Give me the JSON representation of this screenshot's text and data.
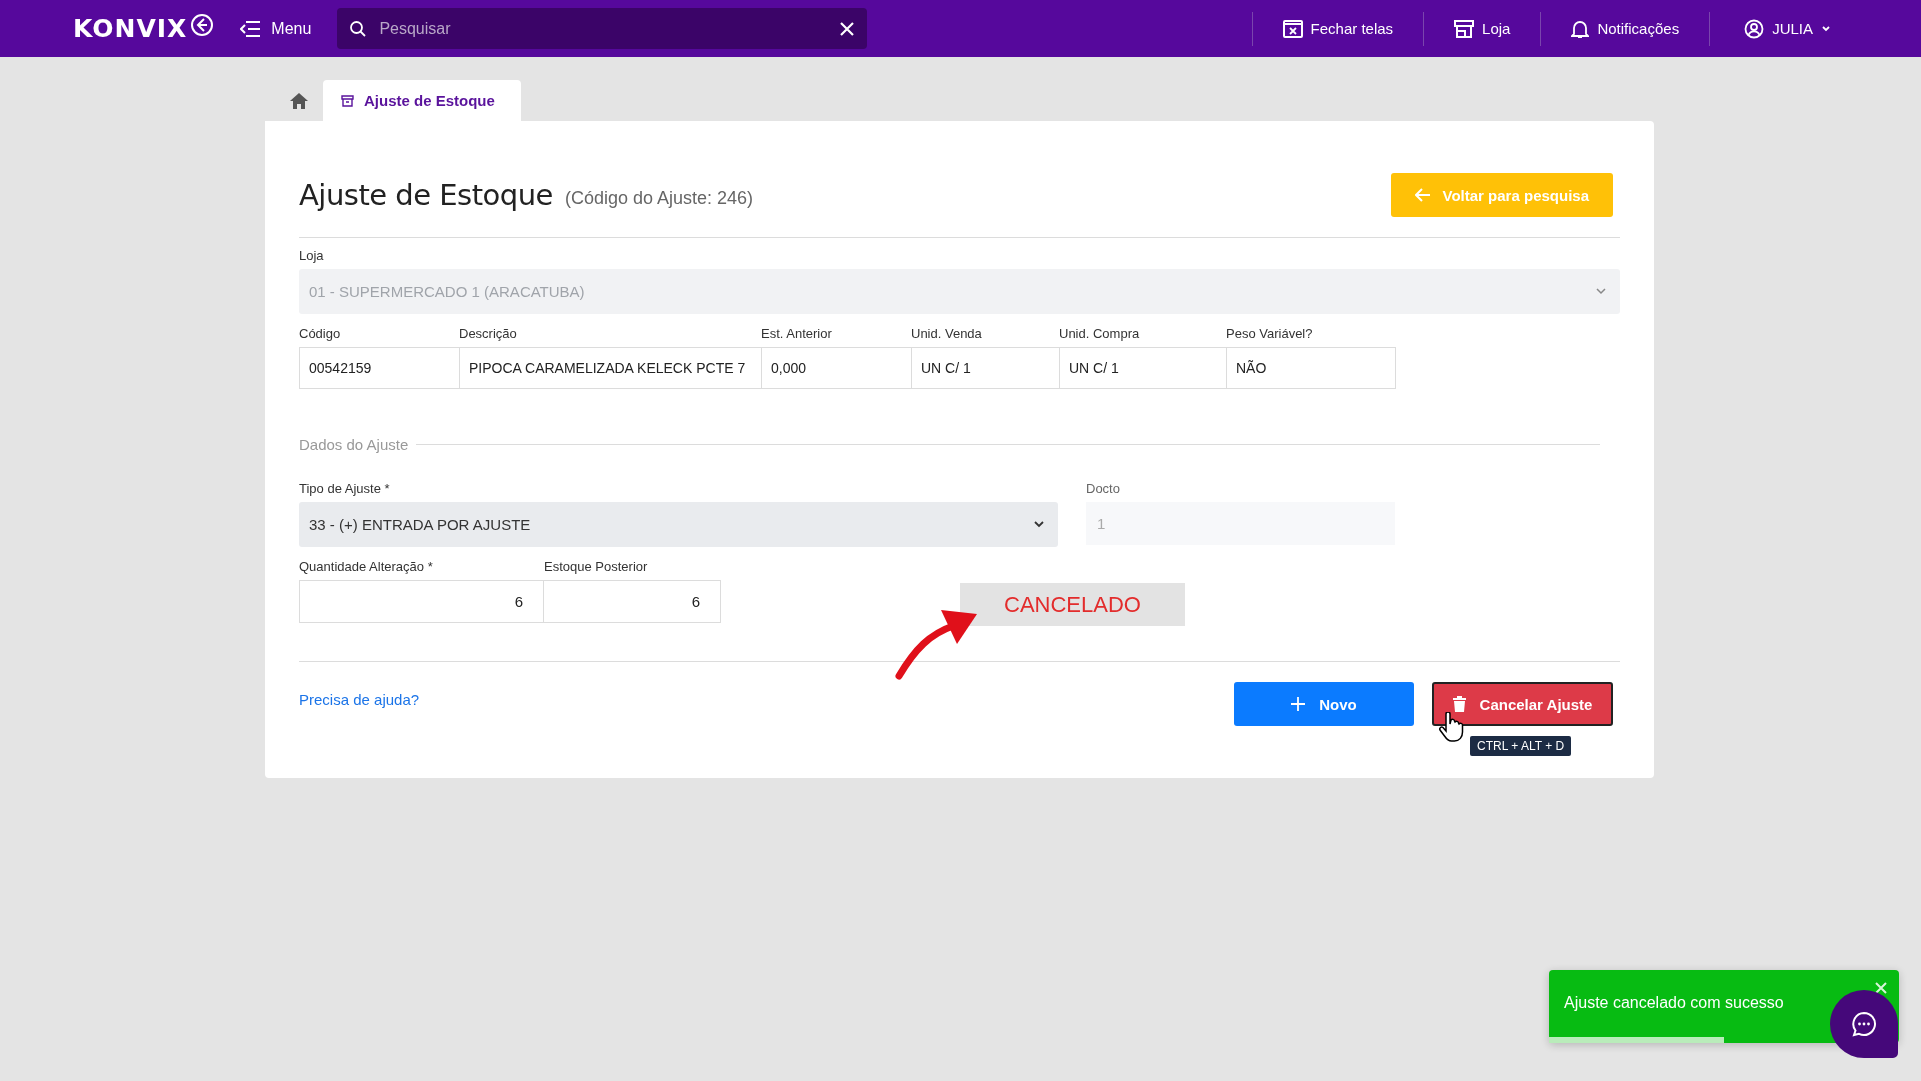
{
  "topbar": {
    "logo": "KONVIX",
    "menu_label": "Menu",
    "search": {
      "placeholder": "Pesquisar"
    },
    "actions": [
      {
        "kind": "close-screens",
        "label": "Fechar telas"
      },
      {
        "kind": "store",
        "label": "Loja"
      },
      {
        "kind": "bell",
        "label": "Notificações"
      }
    ],
    "user": {
      "name": "JULIA"
    }
  },
  "tabs": [
    {
      "kind": "home",
      "selected": false
    },
    {
      "kind": "page",
      "label": "Ajuste de Estoque",
      "selected": true
    }
  ],
  "page": {
    "title": "Ajuste de Estoque",
    "subtitle": "(Código do Ajuste: 246)",
    "back_button": "Voltar para pesquisa"
  },
  "loja": {
    "label": "Loja",
    "value": "01 - SUPERMERCADO 1 (ARACATUBA)",
    "disabled": true
  },
  "product": {
    "columns": [
      "Código",
      "Descrição",
      "Est. Anterior",
      "Unid. Venda",
      "Unid. Compra",
      "Peso Variável?"
    ],
    "values": [
      "00542159",
      "PIPOCA CARAMELIZADA KELECK PCTE 7",
      "0,000",
      "UN C/ 1",
      "UN C/ 1",
      "NÃO"
    ]
  },
  "section": "Dados do Ajuste",
  "tipo": {
    "label": "Tipo de Ajuste *",
    "value": "33 - (+) ENTRADA POR AJUSTE",
    "disabled": false
  },
  "docto": {
    "label": "Docto",
    "value": "1",
    "disabled": true
  },
  "quantidade": {
    "label": "Quantidade Alteração *",
    "value": "6"
  },
  "estoque_posterior": {
    "label": "Estoque Posterior",
    "value": "6"
  },
  "status": "CANCELADO",
  "help_link": "Precisa de ajuda?",
  "buttons": [
    {
      "kind": "primary",
      "label": "Novo"
    },
    {
      "kind": "danger",
      "label": "Cancelar Ajuste"
    }
  ],
  "tooltip": "CTRL + ALT + D",
  "toast": {
    "message": "Ajuste cancelado com sucesso",
    "level": 0.5
  }
}
